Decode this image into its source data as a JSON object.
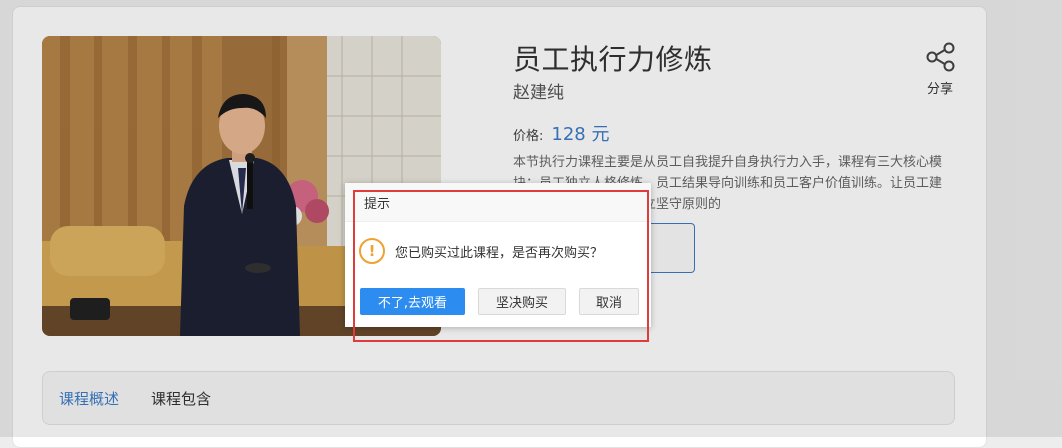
{
  "course": {
    "title": "员工执行力修炼",
    "author": "赵建纯",
    "share_label": "分享",
    "price_label": "价格:",
    "price_value": "128 元",
    "description": "本节执行力课程主要是从员工自我提升自身执行力入手，课程有三大核心模块：员工独立人格修炼、员工结果导向训练和员工客户价值训练。让员工建立起独立承担责任、独立坚守原则的"
  },
  "tabs": [
    {
      "label": "课程概述",
      "active": true
    },
    {
      "label": "课程包含",
      "active": false
    }
  ],
  "dialog": {
    "title": "提示",
    "message": "您已购买过此课程，是否再次购买？",
    "buttons": {
      "watch": "不了,去观看",
      "buy_again": "坚决购买",
      "cancel": "取消"
    }
  },
  "icons": {
    "share": "share-icon",
    "warning": "warning-icon"
  },
  "colors": {
    "accent": "#3b7cc9",
    "primary_button": "#2d8cf0",
    "warning": "#f0a22e",
    "highlight": "#e03c3c"
  }
}
